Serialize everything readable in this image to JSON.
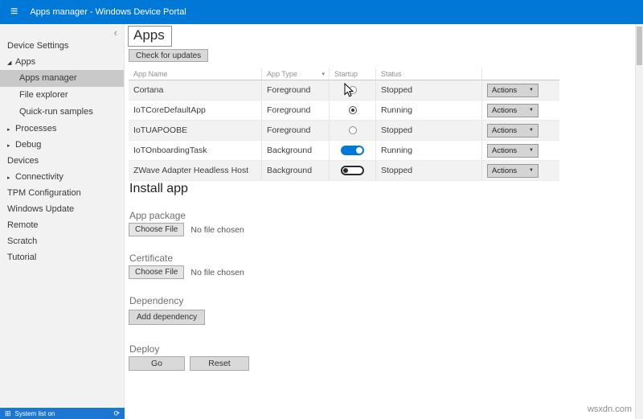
{
  "titlebar": {
    "title": "Apps manager - Windows Device Portal"
  },
  "icons": {
    "menu": "≡",
    "collapse": "‹",
    "sort": "▾",
    "dropdown_arrow": "▼",
    "expanded": "◢",
    "collapsed": "▸",
    "footer_grid": "⊞",
    "footer_refresh": "⟳"
  },
  "sidebar": {
    "items": [
      {
        "label": "Device Settings",
        "type": "plain"
      },
      {
        "label": "Apps",
        "type": "expanded"
      },
      {
        "label": "Apps manager",
        "type": "child",
        "selected": true
      },
      {
        "label": "File explorer",
        "type": "child"
      },
      {
        "label": "Quick-run samples",
        "type": "child"
      },
      {
        "label": "Processes",
        "type": "collapsed"
      },
      {
        "label": "Debug",
        "type": "collapsed"
      },
      {
        "label": "Devices",
        "type": "plain"
      },
      {
        "label": "Connectivity",
        "type": "collapsed"
      },
      {
        "label": "TPM Configuration",
        "type": "plain"
      },
      {
        "label": "Windows Update",
        "type": "plain"
      },
      {
        "label": "Remote",
        "type": "plain"
      },
      {
        "label": "Scratch",
        "type": "plain"
      },
      {
        "label": "Tutorial",
        "type": "plain"
      }
    ],
    "footer": {
      "label": "System list on"
    }
  },
  "main": {
    "heading": "Apps",
    "check_updates_label": "Check for updates",
    "table": {
      "headers": [
        "App Name",
        "App Type",
        "Startup",
        "Status",
        ""
      ],
      "rows": [
        {
          "name": "Cortana",
          "type": "Foreground",
          "startup": "radio-off",
          "status": "Stopped",
          "action": "Actions"
        },
        {
          "name": "IoTCoreDefaultApp",
          "type": "Foreground",
          "startup": "radio-on",
          "status": "Running",
          "action": "Actions"
        },
        {
          "name": "IoTUAPOOBE",
          "type": "Foreground",
          "startup": "radio-off",
          "status": "Stopped",
          "action": "Actions"
        },
        {
          "name": "IoTOnboardingTask",
          "type": "Background",
          "startup": "toggle-on",
          "status": "Running",
          "action": "Actions"
        },
        {
          "name": "ZWave Adapter Headless Host",
          "type": "Background",
          "startup": "toggle-off",
          "status": "Stopped",
          "action": "Actions"
        }
      ]
    },
    "install": {
      "heading": "Install app",
      "app_package_label": "App package",
      "certificate_label": "Certificate",
      "choose_file_label": "Choose File",
      "no_file_label": "No file chosen",
      "dependency_label": "Dependency",
      "add_dependency_label": "Add dependency",
      "deploy_label": "Deploy",
      "go_label": "Go",
      "reset_label": "Reset"
    }
  },
  "watermark": "wsxdn.com"
}
